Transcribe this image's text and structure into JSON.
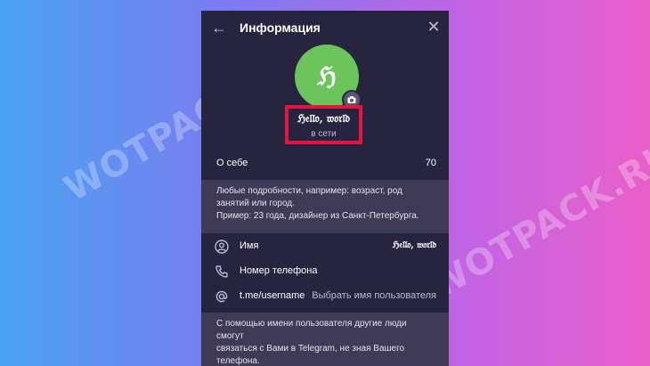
{
  "watermark": "WOTPACK.RU",
  "header": {
    "title": "Информация"
  },
  "profile": {
    "avatar_letter": "ℌ",
    "name": "ℌ𝔢𝔩𝔩𝔬, 𝔴𝔬𝔯𝔩𝔡",
    "status": "в сети"
  },
  "bio": {
    "label": "О себе",
    "remaining": "70",
    "hint_line1": "Любые подробности, например: возраст, род",
    "hint_line2": "занятий или город.",
    "hint_line3": "Пример: 23 года, дизайнер из Санкт-Петербурга."
  },
  "rows": {
    "name": {
      "label": "Имя",
      "value": "ℌ𝔢𝔩𝔩𝔬, 𝔴𝔬𝔯𝔩𝔡",
      "icon": "user-icon"
    },
    "phone": {
      "label": "Номер телефона",
      "icon": "phone-icon"
    },
    "username": {
      "label": "t.me/username",
      "value": "Выбрать имя пользователя",
      "icon": "at-icon"
    }
  },
  "username_hint": {
    "line1": "С помощью имени пользователя другие люди смогут",
    "line2": "связаться с Вами в Telegram, не зная Вашего",
    "line3": "телефона."
  },
  "colors": {
    "panel": "#27243f",
    "accent_green": "#6cc45a",
    "highlight_red": "#e4163c"
  }
}
